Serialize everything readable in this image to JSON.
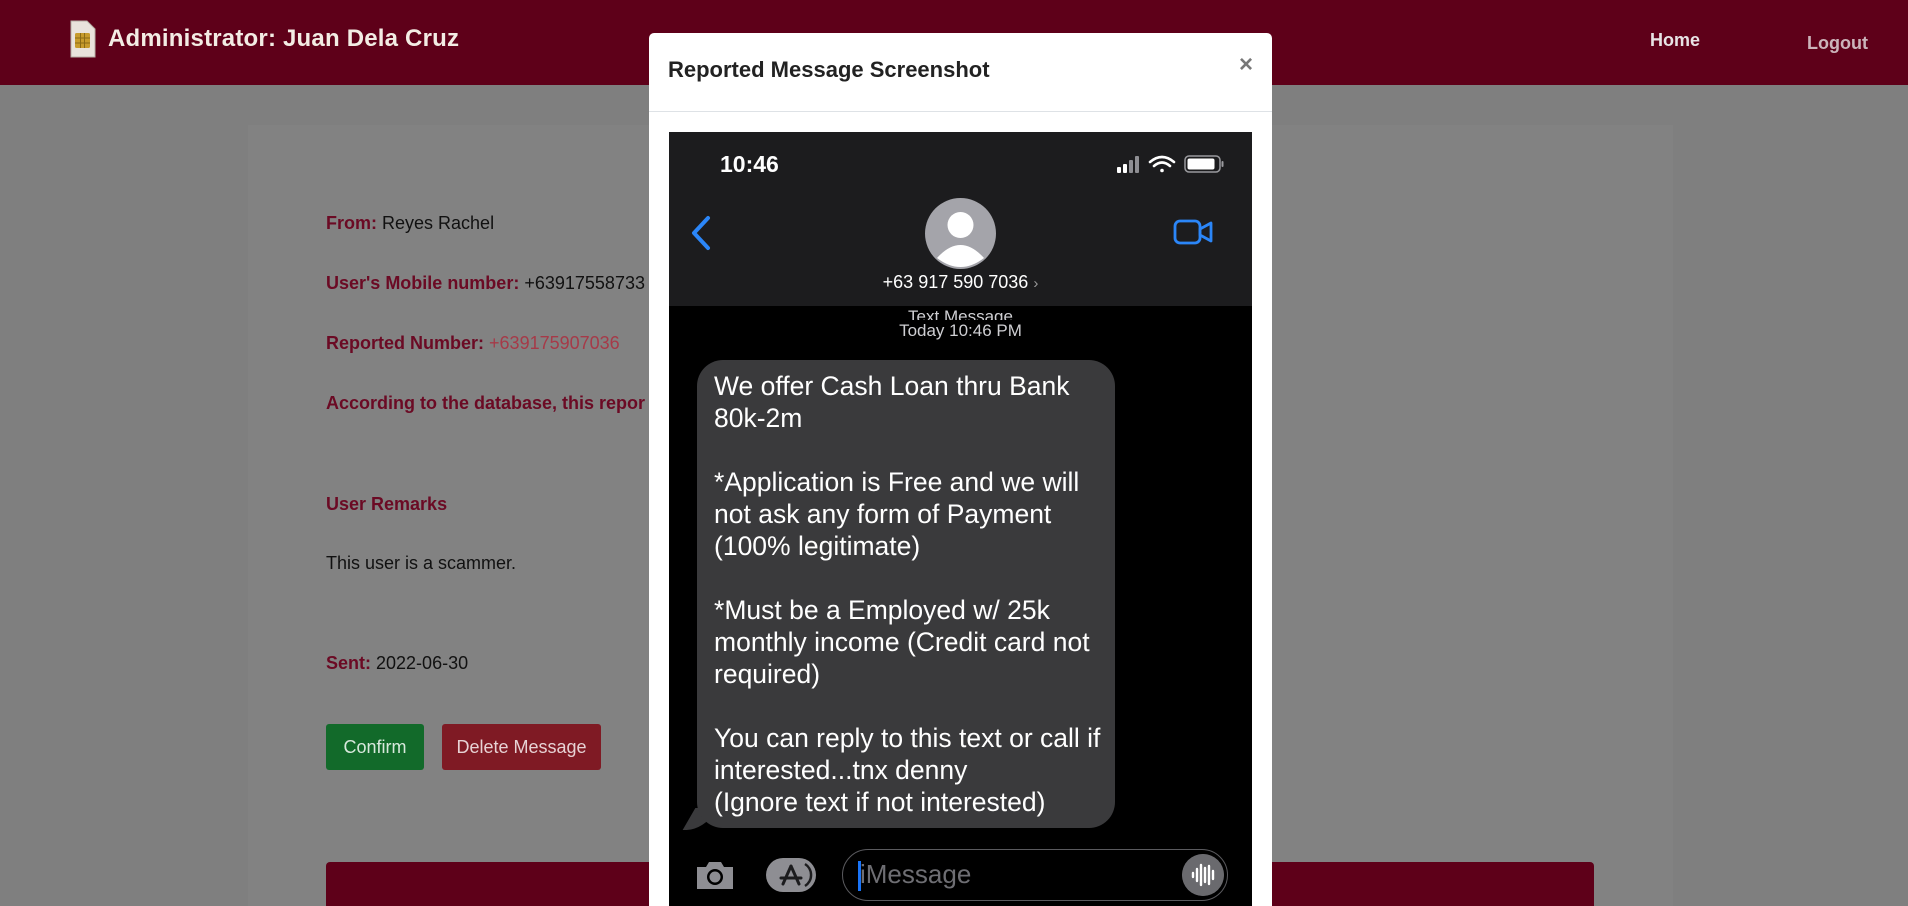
{
  "navbar": {
    "brand": "Administrator: Juan Dela Cruz",
    "links": {
      "home": "Home",
      "logout": "Logout"
    }
  },
  "report": {
    "from_label": "From:",
    "from_value": "Reyes Rachel",
    "mobile_label": "User's Mobile number:",
    "mobile_value": "+63917558733",
    "reported_label": "Reported Number:",
    "reported_value": "+639175907036",
    "database_note": "According to the database, this repor",
    "remarks_title": "User Remarks",
    "remarks_text": "This user is a scammer.",
    "sent_label": "Sent:",
    "sent_value": "2022-06-30",
    "confirm_button": "Confirm",
    "delete_button": "Delete Message"
  },
  "modal": {
    "title": "Reported Message Screenshot",
    "close": "×"
  },
  "phone": {
    "time": "10:46",
    "contact_number": "+63 917 590 7036",
    "contact_chevron": "›",
    "message_type": "Text Message",
    "message_timestamp": "Today 10:46 PM",
    "message_body": "We offer Cash Loan thru Bank 80k-2m\n\n*Application is Free and we will not ask any form of Payment (100% legitimate)\n\n*Must be a Employed w/ 25k monthly income (Credit card not required)\n\nYou can reply to this text or call if interested...tnx denny\n(Ignore text if not interested)",
    "input_placeholder": "iMessage"
  },
  "icons": {
    "brand": "sim-card-icon",
    "signal": "cellular-signal-icon",
    "wifi": "wifi-icon",
    "battery": "battery-icon",
    "back": "chevron-left-icon",
    "video": "video-call-icon",
    "avatar": "contact-avatar-icon",
    "camera": "camera-icon",
    "apps": "app-store-icon",
    "mic": "audio-waveform-icon"
  },
  "colors": {
    "navbar": "#5e0019",
    "label": "#6b0a24",
    "confirm": "#126a2a",
    "delete": "#7f1a24",
    "ios_blue": "#1a74f7",
    "bubble": "#3a3a3c"
  }
}
